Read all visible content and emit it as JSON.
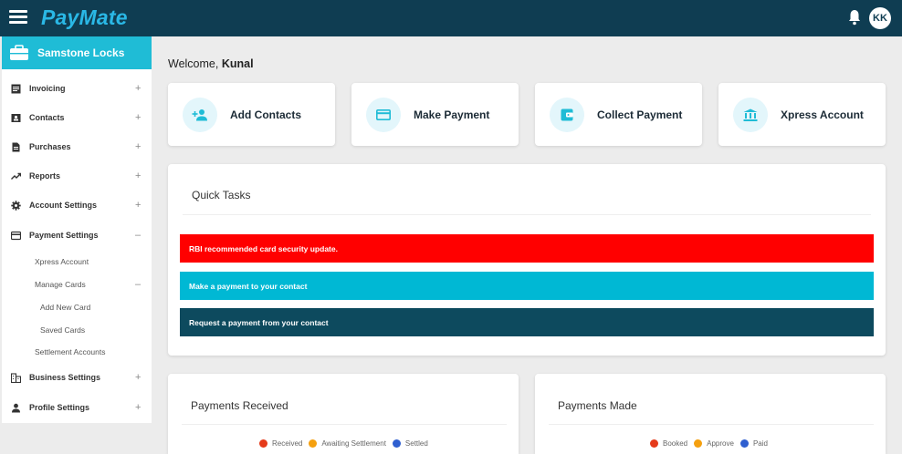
{
  "app": {
    "logo": "PayMate",
    "user_initials": "KK"
  },
  "org": {
    "name": "Samstone Locks"
  },
  "sidebar": {
    "items": [
      {
        "label": "Invoicing",
        "expand": "+"
      },
      {
        "label": "Contacts",
        "expand": "+"
      },
      {
        "label": "Purchases",
        "expand": "+"
      },
      {
        "label": "Reports",
        "expand": "+"
      },
      {
        "label": "Account Settings",
        "expand": "+"
      },
      {
        "label": "Payment Settings",
        "expand": "–"
      },
      {
        "label": "Business Settings",
        "expand": "+"
      },
      {
        "label": "Profile Settings",
        "expand": "+"
      }
    ],
    "payment_sub": {
      "xpress": "Xpress Account",
      "manage_cards": "Manage Cards",
      "manage_cards_expand": "–",
      "add_new_card": "Add New Card",
      "saved_cards": "Saved Cards",
      "settlement": "Settlement Accounts"
    }
  },
  "welcome": {
    "prefix": "Welcome, ",
    "name": "Kunal"
  },
  "quick_actions": [
    {
      "label": "Add Contacts",
      "icon": "add-contact-icon"
    },
    {
      "label": "Make Payment",
      "icon": "card-icon"
    },
    {
      "label": "Collect Payment",
      "icon": "wallet-icon"
    },
    {
      "label": "Xpress Account",
      "icon": "bank-icon"
    }
  ],
  "quick_tasks": {
    "title": "Quick Tasks",
    "items": [
      {
        "label": "RBI recommended card security update.",
        "color": "#ff0000"
      },
      {
        "label": "Make a payment to your contact",
        "color": "#00b8d4"
      },
      {
        "label": "Request a payment from your contact",
        "color": "#0d4a5e"
      }
    ]
  },
  "payments_received": {
    "title": "Payments Received",
    "legend": [
      {
        "label": "Received",
        "color": "#e53a1a"
      },
      {
        "label": "Awaiting Settlement",
        "color": "#f5a00f"
      },
      {
        "label": "Settled",
        "color": "#2f5fd0"
      }
    ]
  },
  "payments_made": {
    "title": "Payments Made",
    "legend": [
      {
        "label": "Booked",
        "color": "#e53a1a"
      },
      {
        "label": "Approve",
        "color": "#f5a00f"
      },
      {
        "label": "Paid",
        "color": "#2f5fd0"
      }
    ]
  },
  "colors": {
    "topbar": "#0f3d52",
    "accent": "#1fbcd6",
    "logo": "#2ab8e6"
  }
}
